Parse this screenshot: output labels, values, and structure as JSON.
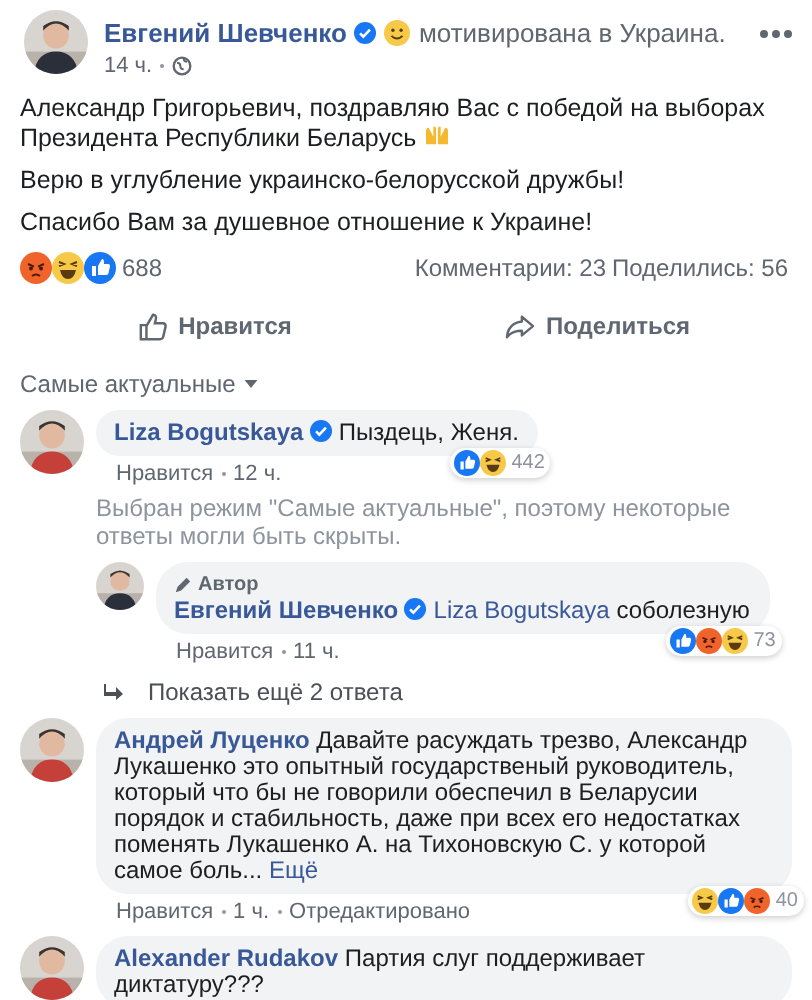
{
  "post": {
    "author": "Евгений Шевченко",
    "verified": true,
    "feeling": "мотивирована в Украина.",
    "time": "14 ч.",
    "paragraphs": [
      {
        "kind": "emoji",
        "text": "Александр Григорьевич, поздравляю Вас с победой на выборах Президента Республики Беларусь"
      },
      {
        "kind": "plain",
        "text": "Верю в углубление украинско-белорусской дружбы!"
      },
      {
        "kind": "plain",
        "text": "Спасибо Вам за душевное отношение к Украине!"
      }
    ],
    "reactions": [
      {
        "kind": "angry"
      },
      {
        "kind": "haha"
      },
      {
        "kind": "like"
      }
    ],
    "reaction_count": "688",
    "comments": "Комментарии: 23",
    "shares": "Поделились: 56"
  },
  "actions": [
    {
      "kind": "like",
      "label": "Нравится"
    },
    {
      "kind": "share",
      "label": "Поделиться"
    }
  ],
  "sort": "Самые актуальные",
  "comments": [
    {
      "author": "Liza Bogutskaya",
      "verified": true,
      "text": "Пыздець, Женя.",
      "reactions": [
        {
          "kind": "like"
        },
        {
          "kind": "haha"
        }
      ],
      "reaction_count": "442",
      "meta": [
        "Нравится",
        "12 ч."
      ],
      "notice": "Выбран режим \"Самые актуальные\", поэтому некоторые ответы могли быть скрыты.",
      "replies": [
        {
          "badge": "Автор",
          "author": "Евгений Шевченко",
          "verified": true,
          "mention": "Liza Bogutskaya",
          "text": "соболезную",
          "reactions": [
            {
              "kind": "like"
            },
            {
              "kind": "angry"
            },
            {
              "kind": "haha"
            }
          ],
          "reaction_count": "73",
          "meta": [
            "Нравится",
            "11 ч."
          ]
        }
      ],
      "more_replies": "Показать ещё 2 ответа"
    },
    {
      "author": "Андрей Луценко",
      "verified": false,
      "text": "Давайте расуждать трезво, Александр Лукашенко это опытный государственый руководитель, который что бы не говорили обеспечил в Беларусии порядок и стабильность, даже при всех его недостатках поменять Лукашенко А. на Тихоновскую С. у которой самое боль...",
      "more_link": "Ещё",
      "reactions": [
        {
          "kind": "haha"
        },
        {
          "kind": "like"
        },
        {
          "kind": "angry"
        }
      ],
      "reaction_count": "40",
      "meta": [
        "Нравится",
        "1 ч.",
        "Отредактировано"
      ]
    },
    {
      "author": "Alexander Rudakov",
      "verified": false,
      "text": "Партия слуг поддерживает диктатуру???"
    }
  ]
}
